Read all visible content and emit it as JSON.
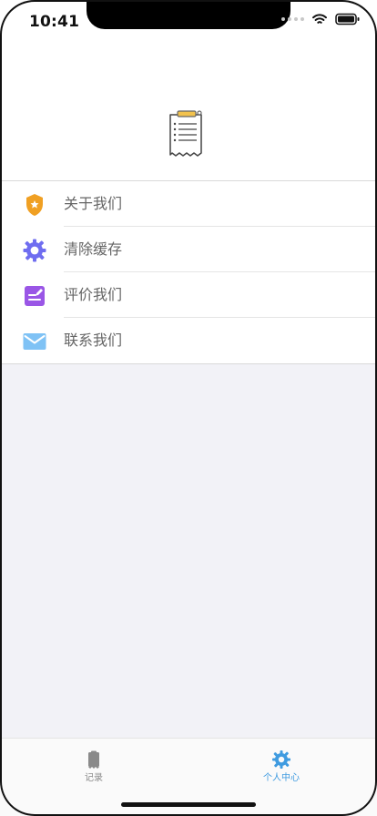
{
  "status_bar": {
    "time": "10:41"
  },
  "header": {
    "icon_name": "clipboard-icon"
  },
  "menu": [
    {
      "label": "关于我们",
      "icon_name": "shield-star-icon",
      "color": "#f0a023"
    },
    {
      "label": "清除缓存",
      "icon_name": "gear-icon",
      "color": "#6f6df0"
    },
    {
      "label": "评价我们",
      "icon_name": "edit-note-icon",
      "color": "#9a56e6"
    },
    {
      "label": "联系我们",
      "icon_name": "envelope-icon",
      "color": "#7fc2f5"
    }
  ],
  "tabbar": {
    "record_label": "记录",
    "profile_label": "个人中心",
    "active_tab": "个人中心",
    "active_color": "#3f9be0",
    "inactive_color": "#8a8a8a"
  }
}
